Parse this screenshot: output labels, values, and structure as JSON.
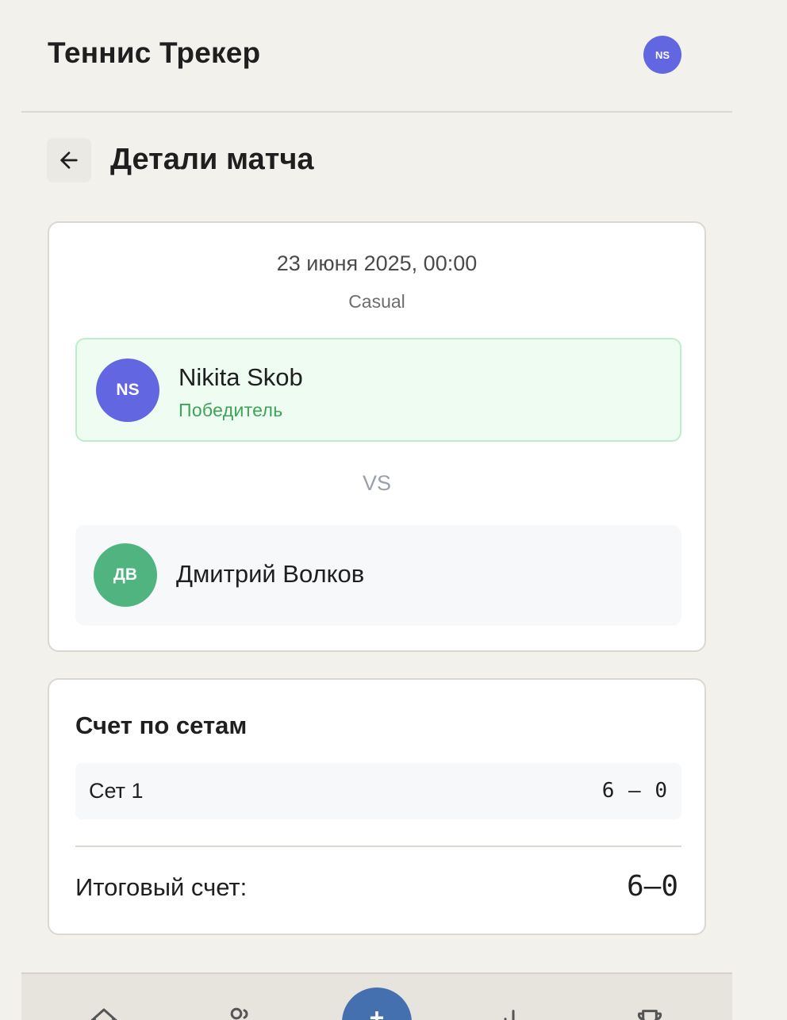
{
  "header": {
    "app_title": "Теннис Трекер",
    "user_initials": "NS",
    "user_avatar_color": "#6366e1"
  },
  "page": {
    "title": "Детали матча",
    "back_icon": "arrow-left-icon"
  },
  "match": {
    "date": "23 июня 2025, 00:00",
    "type": "Casual",
    "vs_label": "VS",
    "winner": {
      "initials": "NS",
      "name": "Nikita Skob",
      "status": "Победитель",
      "avatar_color": "#6366e1"
    },
    "opponent": {
      "initials": "ДВ",
      "name": "Дмитрий Волков",
      "avatar_color": "#4fb47f"
    }
  },
  "sets": {
    "title": "Счет по сетам",
    "rows": [
      {
        "label": "Сет 1",
        "score": "6 – 0"
      }
    ],
    "total_label": "Итоговый счет:",
    "total_score": "6–0"
  },
  "bottom_nav": {
    "items": [
      {
        "icon": "home-icon"
      },
      {
        "icon": "users-icon"
      },
      {
        "icon": "plus-icon",
        "label": "+"
      },
      {
        "icon": "bar-chart-icon"
      },
      {
        "icon": "trophy-icon"
      }
    ]
  },
  "colors": {
    "background": "#f3f1ec",
    "winner_bg": "#effcf2",
    "winner_text": "#3ea35a",
    "accent_blue": "#4470b0"
  }
}
